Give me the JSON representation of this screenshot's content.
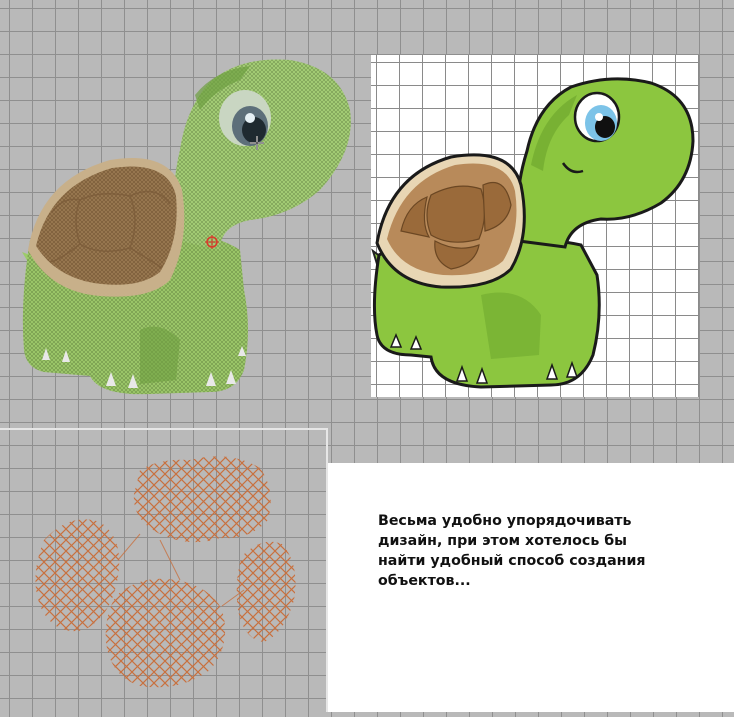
{
  "note": {
    "text": "Весьма удобно упорядочивать\nдизайн, при этом хотелось бы\nнайти удобный способ создания\nобъектов..."
  },
  "icons": {
    "cursor": "move-cursor-icon",
    "marker": "stitch-marker-icon"
  },
  "colors": {
    "canvas": "#b9b9b9",
    "grid": "#8f8f8f",
    "turtle_green": "#93c25b",
    "shell_brown": "#9a7a52",
    "stitch_orange": "#c8703e"
  }
}
